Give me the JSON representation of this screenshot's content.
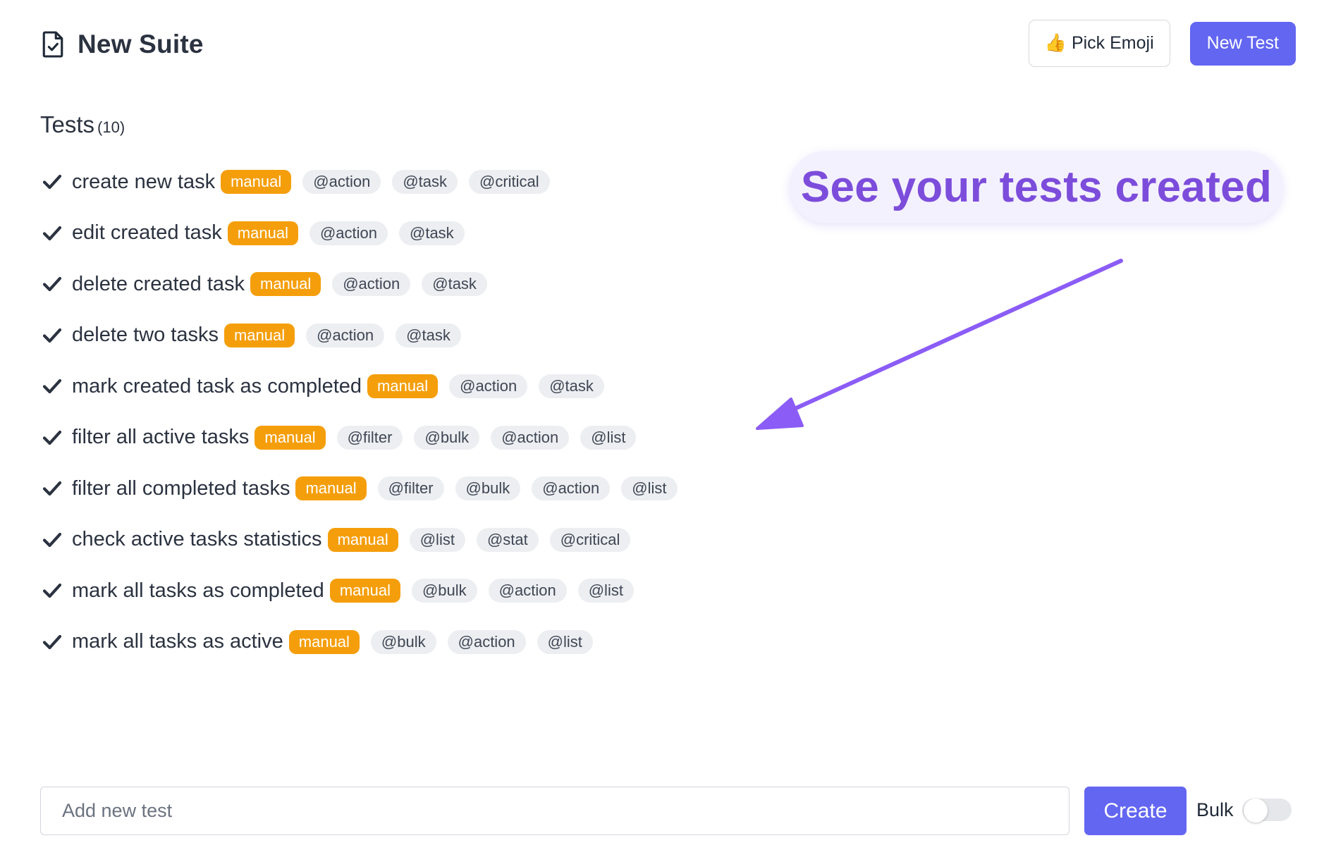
{
  "header": {
    "suite_title": "New Suite",
    "pick_emoji_label": "👍 Pick Emoji",
    "new_test_label": "New Test"
  },
  "tests_section": {
    "heading": "Tests",
    "count": "(10)"
  },
  "badge_label": "manual",
  "tests": [
    {
      "name": "create new task",
      "tags": [
        "@action",
        "@task",
        "@critical"
      ]
    },
    {
      "name": "edit created task",
      "tags": [
        "@action",
        "@task"
      ]
    },
    {
      "name": "delete created task",
      "tags": [
        "@action",
        "@task"
      ]
    },
    {
      "name": "delete two tasks",
      "tags": [
        "@action",
        "@task"
      ]
    },
    {
      "name": "mark created task as completed",
      "tags": [
        "@action",
        "@task"
      ]
    },
    {
      "name": "filter all active tasks",
      "tags": [
        "@filter",
        "@bulk",
        "@action",
        "@list"
      ]
    },
    {
      "name": "filter all completed tasks",
      "tags": [
        "@filter",
        "@bulk",
        "@action",
        "@list"
      ]
    },
    {
      "name": "check active tasks statistics",
      "tags": [
        "@list",
        "@stat",
        "@critical"
      ]
    },
    {
      "name": "mark all tasks as completed",
      "tags": [
        "@bulk",
        "@action",
        "@list"
      ]
    },
    {
      "name": "mark all tasks as active",
      "tags": [
        "@bulk",
        "@action",
        "@list"
      ]
    }
  ],
  "callout": {
    "text": "See your tests created"
  },
  "footer": {
    "add_placeholder": "Add new test",
    "create_label": "Create",
    "bulk_label": "Bulk",
    "bulk_enabled": false
  },
  "colors": {
    "accent": "#6366f1",
    "manual_badge": "#f59e0b",
    "tag_bg": "#eceef1",
    "callout_text": "#7c4ddb",
    "arrow": "#8b5cf6"
  },
  "icons": {
    "suite": "document-check-icon",
    "test_status": "checkmark-icon"
  }
}
